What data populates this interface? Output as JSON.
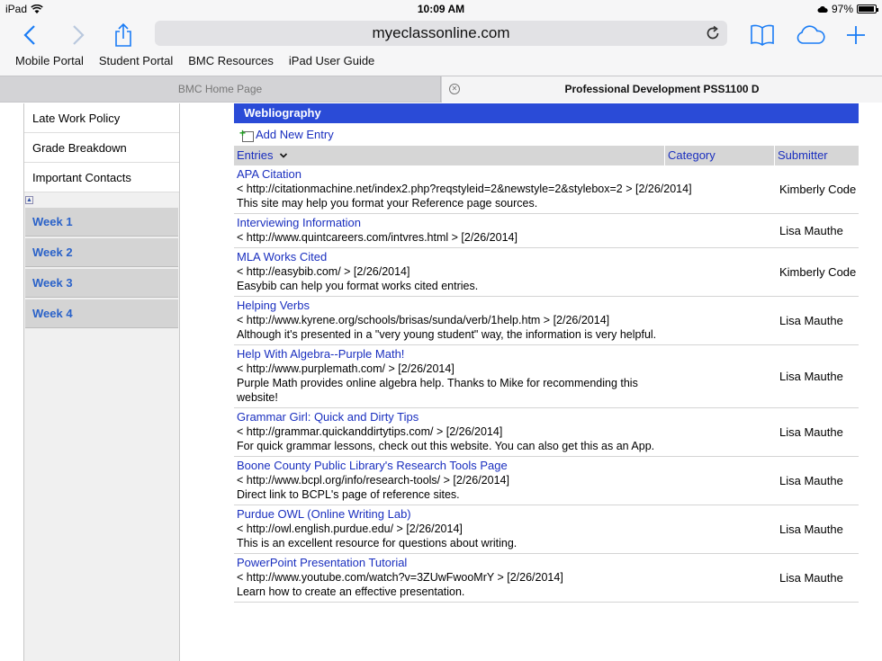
{
  "status": {
    "device": "iPad",
    "time": "10:09 AM",
    "battery_text": "97%",
    "battery_level": 0.97
  },
  "browser": {
    "url": "myeclassonline.com",
    "bookmarks": [
      "Mobile Portal",
      "Student Portal",
      "BMC Resources",
      "iPad User Guide"
    ]
  },
  "tabs": {
    "inactive": "BMC Home Page",
    "active": "Professional Development PSS1100 D"
  },
  "sidebar": {
    "links": [
      "Late Work Policy",
      "Grade Breakdown",
      "Important Contacts"
    ],
    "weeks": [
      "Week 1",
      "Week 2",
      "Week 3",
      "Week 4"
    ]
  },
  "main": {
    "header": "Webliography",
    "add_entry": "Add New Entry",
    "columns": {
      "entries": "Entries",
      "category": "Category",
      "submitter": "Submitter"
    },
    "entries": [
      {
        "title": "APA Citation",
        "url": "< http://citationmachine.net/index2.php?reqstyleid=2&newstyle=2&stylebox=2 > [2/26/2014]",
        "desc": "This site may help you format your Reference page sources.",
        "submitter": "Kimberly Code"
      },
      {
        "title": "Interviewing Information",
        "url": "< http://www.quintcareers.com/intvres.html > [2/26/2014]",
        "desc": "",
        "submitter": "Lisa Mauthe"
      },
      {
        "title": "MLA Works Cited",
        "url": "< http://easybib.com/ > [2/26/2014]",
        "desc": "Easybib can help you format works cited entries.",
        "submitter": "Kimberly Code"
      },
      {
        "title": "Helping Verbs",
        "url": "< http://www.kyrene.org/schools/brisas/sunda/verb/1help.htm > [2/26/2014]",
        "desc": "Although it's presented in a \"very young student\" way, the information is very helpful.",
        "submitter": "Lisa Mauthe"
      },
      {
        "title": "Help With Algebra--Purple Math!",
        "url": "< http://www.purplemath.com/ > [2/26/2014]",
        "desc": "Purple Math provides online algebra help. Thanks to Mike for recommending this website!",
        "submitter": "Lisa Mauthe"
      },
      {
        "title": "Grammar Girl: Quick and Dirty Tips",
        "url": "< http://grammar.quickanddirtytips.com/ > [2/26/2014]",
        "desc": "For quick grammar lessons, check out this website. You can also get this as an App.",
        "submitter": "Lisa Mauthe"
      },
      {
        "title": "Boone County Public Library's Research Tools Page",
        "url": "< http://www.bcpl.org/info/research-tools/ > [2/26/2014]",
        "desc": "Direct link to BCPL's page of reference sites.",
        "submitter": "Lisa Mauthe"
      },
      {
        "title": "Purdue OWL (Online Writing Lab)",
        "url": "< http://owl.english.purdue.edu/ > [2/26/2014]",
        "desc": "This is an excellent resource for questions about writing.",
        "submitter": "Lisa Mauthe"
      },
      {
        "title": "PowerPoint Presentation Tutorial",
        "url": "< http://www.youtube.com/watch?v=3ZUwFwooMrY > [2/26/2014]",
        "desc": "Learn how to create an effective presentation.",
        "submitter": "Lisa Mauthe"
      }
    ]
  },
  "colors": {
    "accent": "#1a7cf5",
    "header_blue": "#2a4bd7",
    "link_blue": "#1a2fbf",
    "week_blue": "#2a62c9"
  },
  "icons": [
    "wifi-icon",
    "cloud-status-icon",
    "battery-icon",
    "back-icon",
    "forward-icon",
    "share-icon",
    "reload-icon",
    "bookmarks-book-icon",
    "icloud-tabs-icon",
    "new-tab-plus-icon",
    "tab-close-icon",
    "collapse-icon",
    "add-entry-icon",
    "sort-chevron-icon"
  ]
}
